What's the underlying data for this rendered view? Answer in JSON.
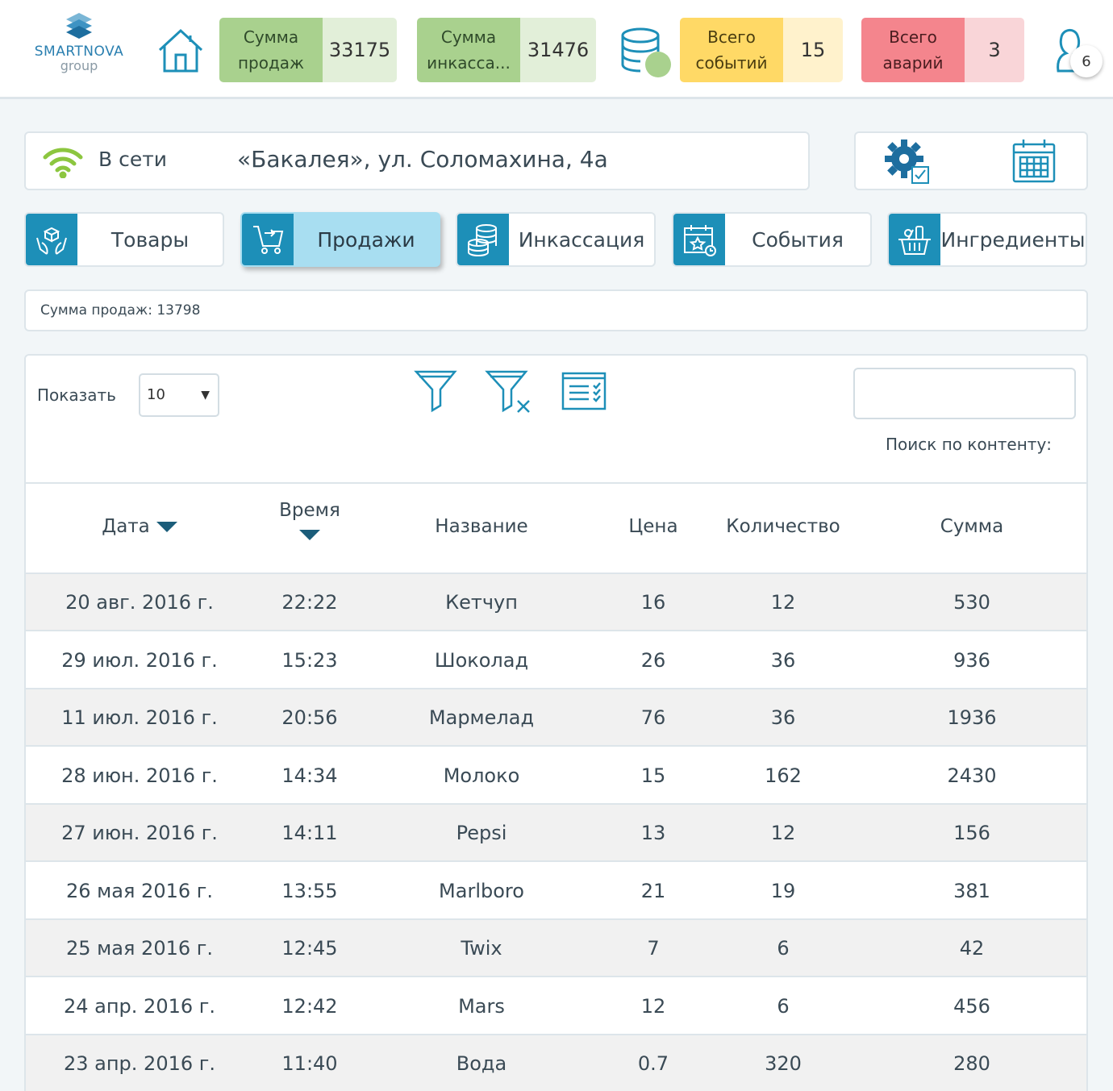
{
  "logo": {
    "brand": "SMARTNOVA",
    "sub": "group"
  },
  "header": {
    "stats": [
      {
        "label_line1": "Сумма",
        "label_line2": "продаж",
        "value": "33175",
        "color": "#a9d18e"
      },
      {
        "label_line1": "Сумма",
        "label_line2": "инкасса...",
        "value": "31476",
        "color": "#a9d18e"
      },
      {
        "label_line1": "Всего",
        "label_line2": "событий",
        "value": "15",
        "color": "#ffd966"
      },
      {
        "label_line1": "Всего",
        "label_line2": "аварий",
        "value": "3",
        "color": "#f4858d"
      }
    ],
    "user_badge": "6",
    "icons": {
      "home": "home-icon",
      "database": "database-icon",
      "user": "user-icon"
    }
  },
  "status": {
    "connection": "В сети",
    "shop": "«Бакалея», ул. Соломахина, 4а",
    "icons": {
      "wifi": "wifi-icon",
      "settings": "gear-icon",
      "calendar": "calendar-icon"
    }
  },
  "tabs": [
    {
      "label": "Товары",
      "icon": "hands-box-icon",
      "active": false
    },
    {
      "label": "Продажи",
      "icon": "cart-icon",
      "active": true
    },
    {
      "label": "Инкассация",
      "icon": "coins-icon",
      "active": false
    },
    {
      "label": "События",
      "icon": "calendar-star-icon",
      "active": false
    },
    {
      "label": "Ингредиенты",
      "icon": "basket-icon",
      "active": false
    }
  ],
  "summary": "Сумма продаж: 13798",
  "controls": {
    "show_label": "Показать",
    "page_size": "10",
    "search_label": "Поиск по контенту:",
    "search_value": "",
    "icons": {
      "filter": "filter-icon",
      "clear_filter": "filter-clear-icon",
      "columns": "checklist-icon"
    }
  },
  "table": {
    "headers": {
      "date": "Дата",
      "time": "Время",
      "name": "Название",
      "price": "Цена",
      "qty": "Количество",
      "sum": "Сумма"
    },
    "rows": [
      {
        "date": "20 авг. 2016 г.",
        "time": "22:22",
        "name": "Кетчуп",
        "price": "16",
        "qty": "12",
        "sum": "530"
      },
      {
        "date": "29 июл. 2016 г.",
        "time": "15:23",
        "name": "Шоколад",
        "price": "26",
        "qty": "36",
        "sum": "936"
      },
      {
        "date": "11 июл. 2016 г.",
        "time": "20:56",
        "name": "Мармелад",
        "price": "76",
        "qty": "36",
        "sum": "1936"
      },
      {
        "date": "28 июн. 2016 г.",
        "time": "14:34",
        "name": "Молоко",
        "price": "15",
        "qty": "162",
        "sum": "2430"
      },
      {
        "date": "27 июн. 2016 г.",
        "time": "14:11",
        "name": "Pepsi",
        "price": "13",
        "qty": "12",
        "sum": "156"
      },
      {
        "date": "26 мая 2016 г.",
        "time": "13:55",
        "name": "Marlboro",
        "price": "21",
        "qty": "19",
        "sum": "381"
      },
      {
        "date": "25 мая 2016 г.",
        "time": "12:45",
        "name": "Twix",
        "price": "7",
        "qty": "6",
        "sum": "42"
      },
      {
        "date": "24 апр. 2016 г.",
        "time": "12:42",
        "name": "Mars",
        "price": "12",
        "qty": "6",
        "sum": "456"
      },
      {
        "date": "23 апр. 2016 г.",
        "time": "11:40",
        "name": "Вода",
        "price": "0.7",
        "qty": "320",
        "sum": "280"
      }
    ]
  },
  "colors": {
    "accent": "#1d8fb8",
    "active_tab": "#a8def1",
    "online": "#8cc63f"
  }
}
